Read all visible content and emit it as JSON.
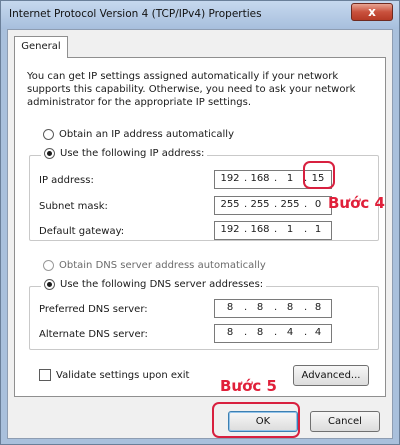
{
  "window": {
    "title": "Internet Protocol Version 4 (TCP/IPv4) Properties",
    "close_label": "x"
  },
  "tabs": [
    "General"
  ],
  "description": "You can get IP settings assigned automatically if your network supports this capability. Otherwise, you need to ask your network administrator for the appropriate IP settings.",
  "ip_mode": {
    "auto_label": "Obtain an IP address automatically",
    "auto_selected": false,
    "manual_label": "Use the following IP address:",
    "manual_selected": true
  },
  "ip_fields": [
    {
      "label": "IP address:",
      "octets": [
        "192",
        "168",
        "1",
        "15"
      ]
    },
    {
      "label": "Subnet mask:",
      "octets": [
        "255",
        "255",
        "255",
        "0"
      ]
    },
    {
      "label": "Default gateway:",
      "octets": [
        "192",
        "168",
        "1",
        "1"
      ]
    }
  ],
  "dns_mode": {
    "auto_label": "Obtain DNS server address automatically",
    "auto_selected": false,
    "manual_label": "Use the following DNS server addresses:",
    "manual_selected": true
  },
  "dns_fields": [
    {
      "label": "Preferred DNS server:",
      "octets": [
        "8",
        "8",
        "8",
        "8"
      ]
    },
    {
      "label": "Alternate DNS server:",
      "octets": [
        "8",
        "8",
        "4",
        "4"
      ]
    }
  ],
  "validate": {
    "label": "Validate settings upon exit",
    "checked": false
  },
  "buttons": {
    "advanced": "Advanced...",
    "ok": "OK",
    "cancel": "Cancel"
  },
  "annotations": {
    "step4": "Bước 4",
    "step5": "Bước 5",
    "color": "#e0203a"
  }
}
